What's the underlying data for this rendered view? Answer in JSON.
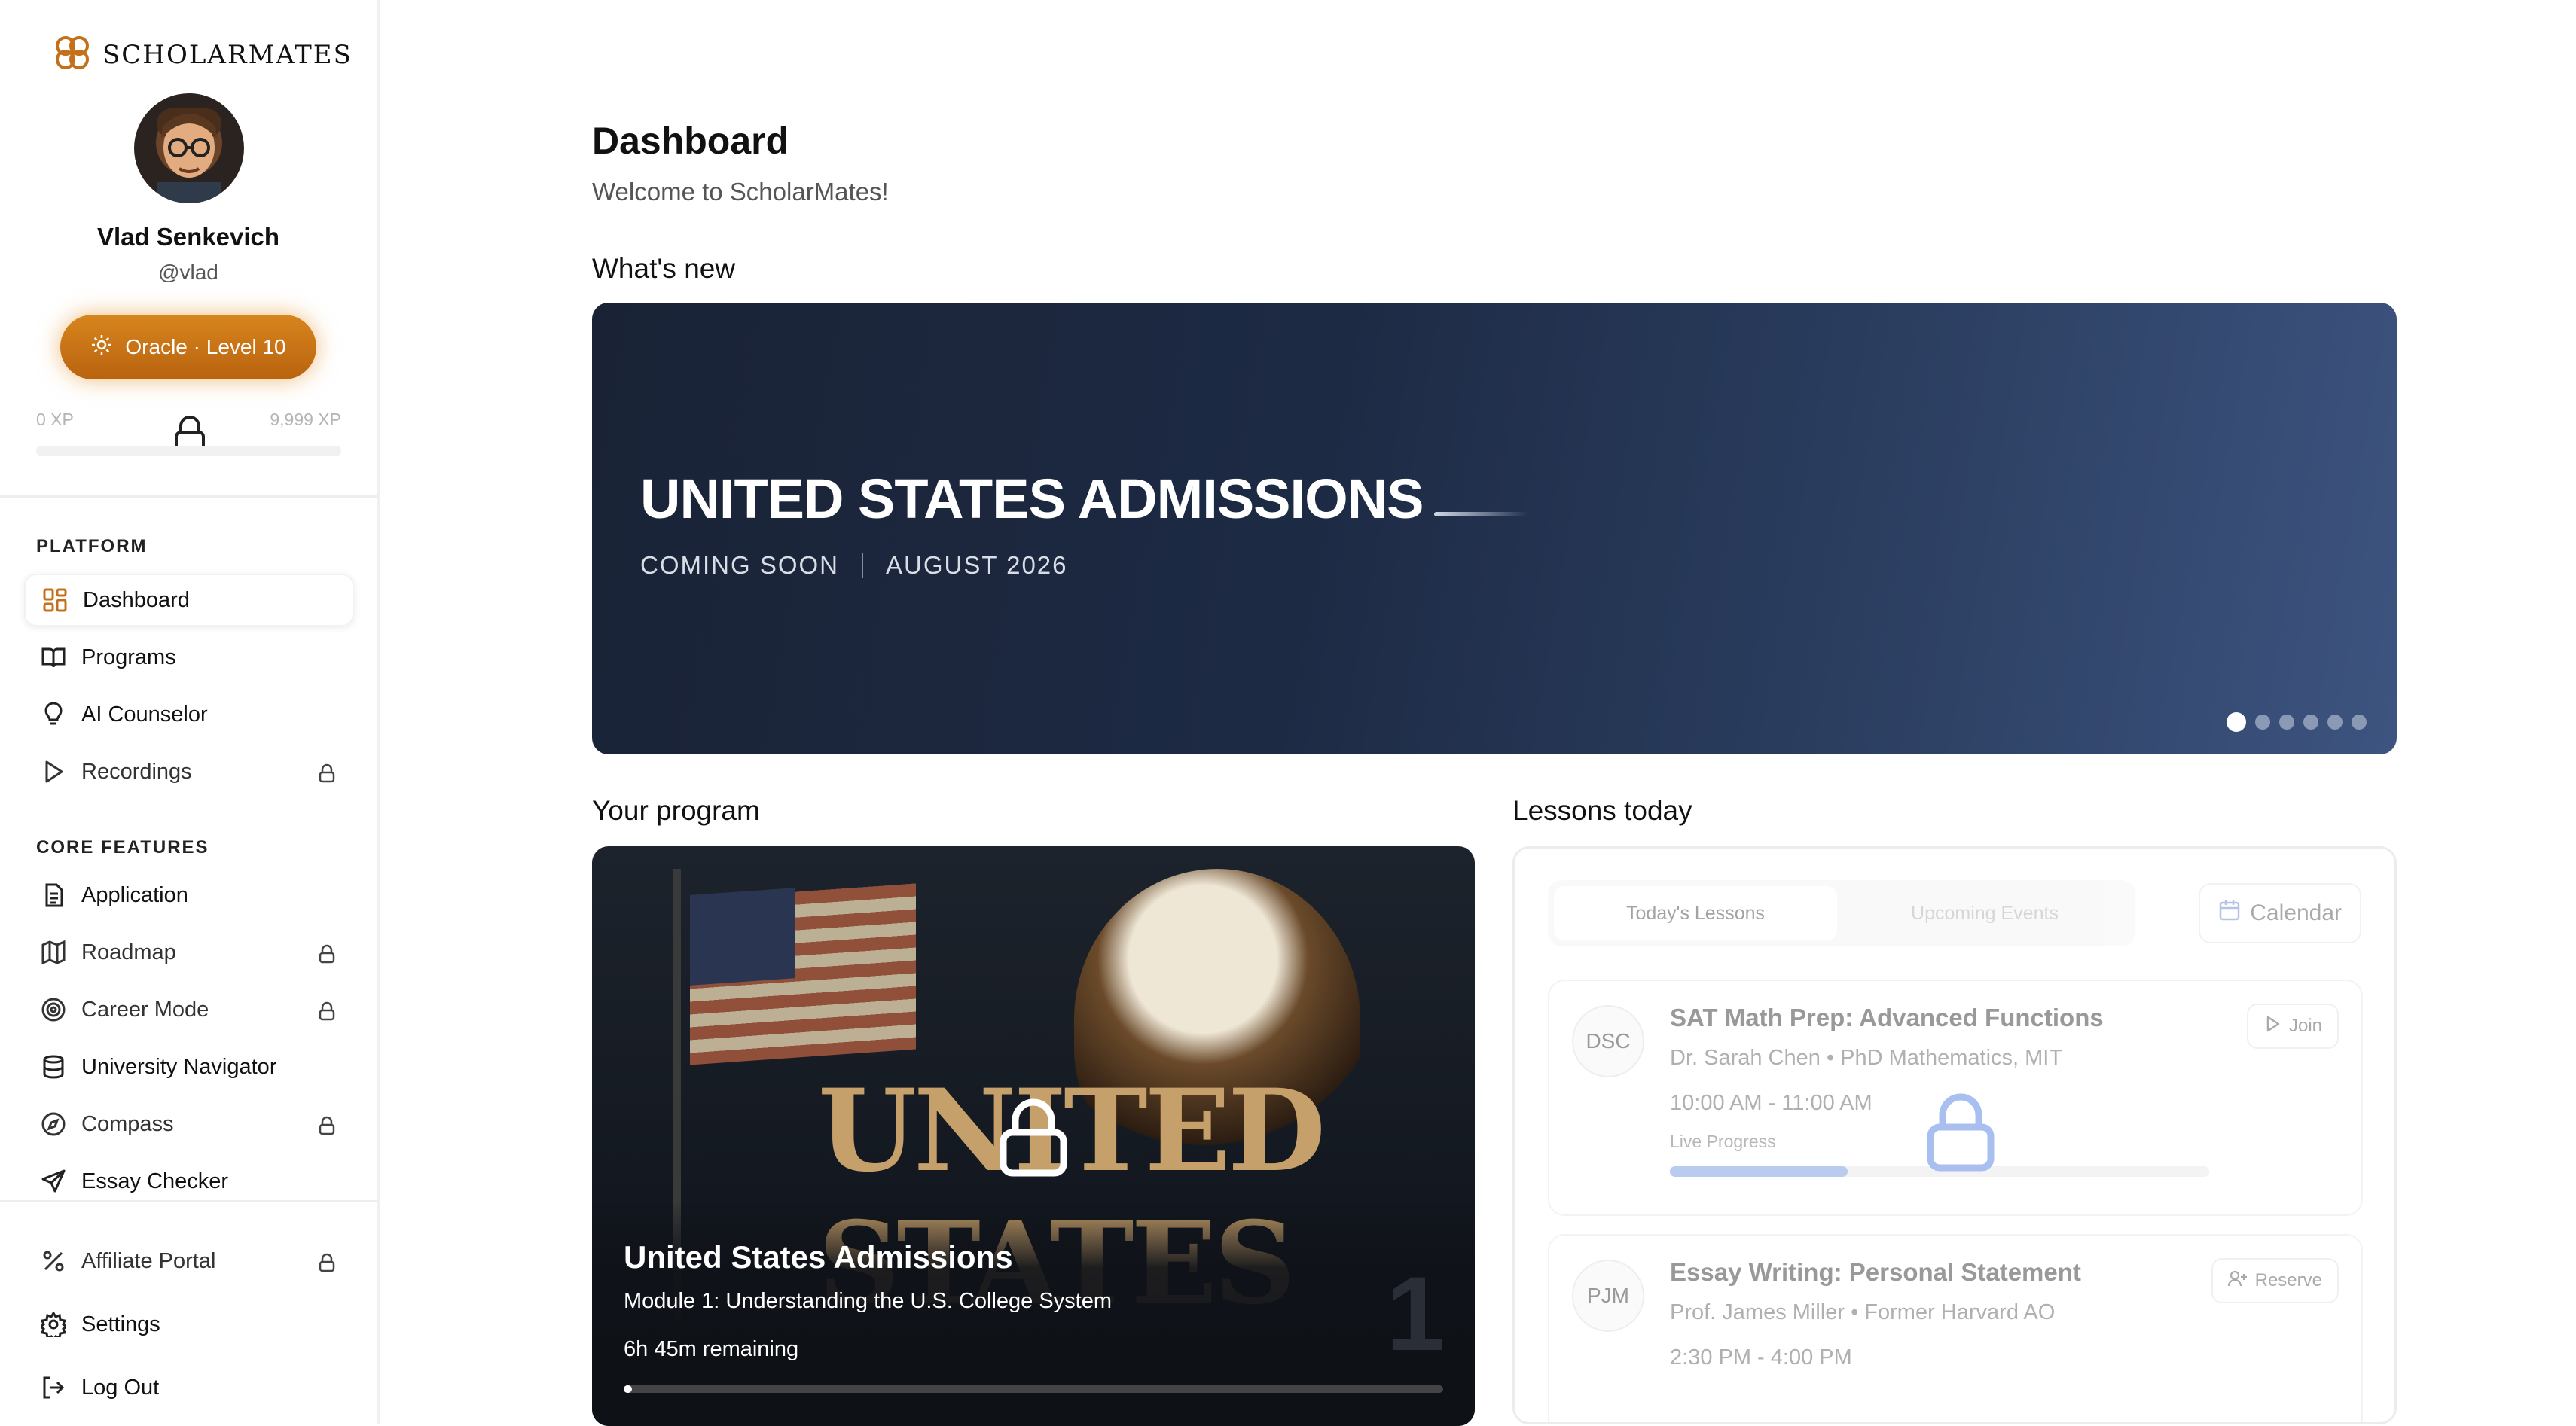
{
  "app": {
    "logo_text": "SCHOLARMATES"
  },
  "profile": {
    "name": "Vlad Senkevich",
    "handle": "@vlad",
    "level_label": "Oracle · Level 10",
    "xp_min": "0 XP",
    "xp_max": "9,999 XP",
    "xp_progress": 0
  },
  "sidebar": {
    "platform_heading": "PLATFORM",
    "platform_items": [
      {
        "label": "Dashboard",
        "icon": "grid-icon",
        "active": true,
        "locked": false
      },
      {
        "label": "Programs",
        "icon": "book-icon",
        "locked": false
      },
      {
        "label": "AI Counselor",
        "icon": "lightbulb-icon",
        "locked": false
      },
      {
        "label": "Recordings",
        "icon": "play-icon",
        "locked": true
      }
    ],
    "core_heading": "CORE FEATURES",
    "core_items": [
      {
        "label": "Application",
        "icon": "document-icon",
        "locked": false
      },
      {
        "label": "Roadmap",
        "icon": "map-icon",
        "locked": true
      },
      {
        "label": "Career Mode",
        "icon": "target-icon",
        "locked": true
      },
      {
        "label": "University Navigator",
        "icon": "database-icon",
        "locked": false
      },
      {
        "label": "Compass",
        "icon": "compass-icon",
        "locked": true
      },
      {
        "label": "Essay Checker",
        "icon": "send-icon",
        "locked": false
      }
    ],
    "bottom_items": [
      {
        "label": "Affiliate Portal",
        "icon": "percent-icon",
        "locked": true
      },
      {
        "label": "Settings",
        "icon": "gear-icon",
        "locked": false
      },
      {
        "label": "Log Out",
        "icon": "logout-icon",
        "locked": false
      }
    ]
  },
  "main": {
    "title": "Dashboard",
    "subtitle": "Welcome to ScholarMates!",
    "whats_new_heading": "What's new",
    "banner": {
      "title": "UNITED STATES ADMISSIONS",
      "status": "COMING SOON",
      "date": "AUGUST 2026",
      "slide_count": 6,
      "active_slide": 1
    },
    "program_heading": "Your program",
    "program": {
      "image_text": "UNITED STATES",
      "title": "United States Admissions",
      "module": "Module 1: Understanding the U.S. College System",
      "remaining": "6h 45m remaining",
      "number": "1",
      "progress": 0.01
    },
    "lessons_heading": "Lessons today",
    "lessons": {
      "tabs": [
        "Today's Lessons",
        "Upcoming Events"
      ],
      "calendar_label": "Calendar",
      "items": [
        {
          "initials": "DSC",
          "title": "SAT Math Prep: Advanced Functions",
          "teacher": "Dr. Sarah Chen • PhD Mathematics, MIT",
          "time": "10:00 AM - 11:00 AM",
          "action": "Join",
          "progress_label": "Live Progress",
          "progress": 0.33
        },
        {
          "initials": "PJM",
          "title": "Essay Writing: Personal Statement",
          "teacher": "Prof. James Miller • Former Harvard AO",
          "time": "2:30 PM - 4:00 PM",
          "action": "Reserve"
        }
      ]
    }
  },
  "colors": {
    "accent": "#c4701a",
    "banner_dark": "#1a2336",
    "banner_light": "#3d5480",
    "lock_blue": "#9fb6e8"
  }
}
